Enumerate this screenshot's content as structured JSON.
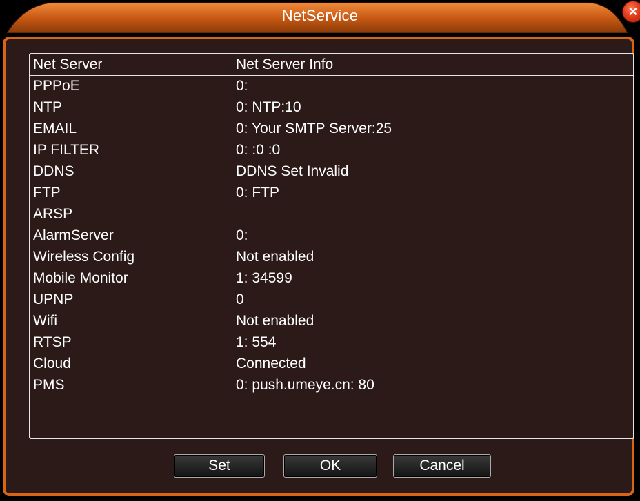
{
  "window": {
    "title": "NetService",
    "close_icon": "close-icon",
    "accent_color": "#d86418"
  },
  "table": {
    "headers": {
      "server": "Net Server",
      "info": "Net Server Info"
    },
    "rows": [
      {
        "server": "PPPoE",
        "info": "0:"
      },
      {
        "server": "NTP",
        "info": "0: NTP:10"
      },
      {
        "server": "EMAIL",
        "info": "0: Your SMTP Server:25"
      },
      {
        "server": "IP FILTER",
        "info": "0: :0 :0"
      },
      {
        "server": "DDNS",
        "info": "DDNS Set Invalid"
      },
      {
        "server": "FTP",
        "info": "0: FTP"
      },
      {
        "server": "ARSP",
        "info": ""
      },
      {
        "server": "AlarmServer",
        "info": "0:"
      },
      {
        "server": "Wireless Config",
        "info": "Not enabled"
      },
      {
        "server": "Mobile Monitor",
        "info": "1: 34599"
      },
      {
        "server": "UPNP",
        "info": "0"
      },
      {
        "server": "Wifi",
        "info": "Not enabled"
      },
      {
        "server": "RTSP",
        "info": "1: 554"
      },
      {
        "server": "Cloud",
        "info": "Connected"
      },
      {
        "server": "PMS",
        "info": "0: push.umeye.cn: 80"
      }
    ]
  },
  "buttons": {
    "set": "Set",
    "ok": "OK",
    "cancel": "Cancel"
  }
}
